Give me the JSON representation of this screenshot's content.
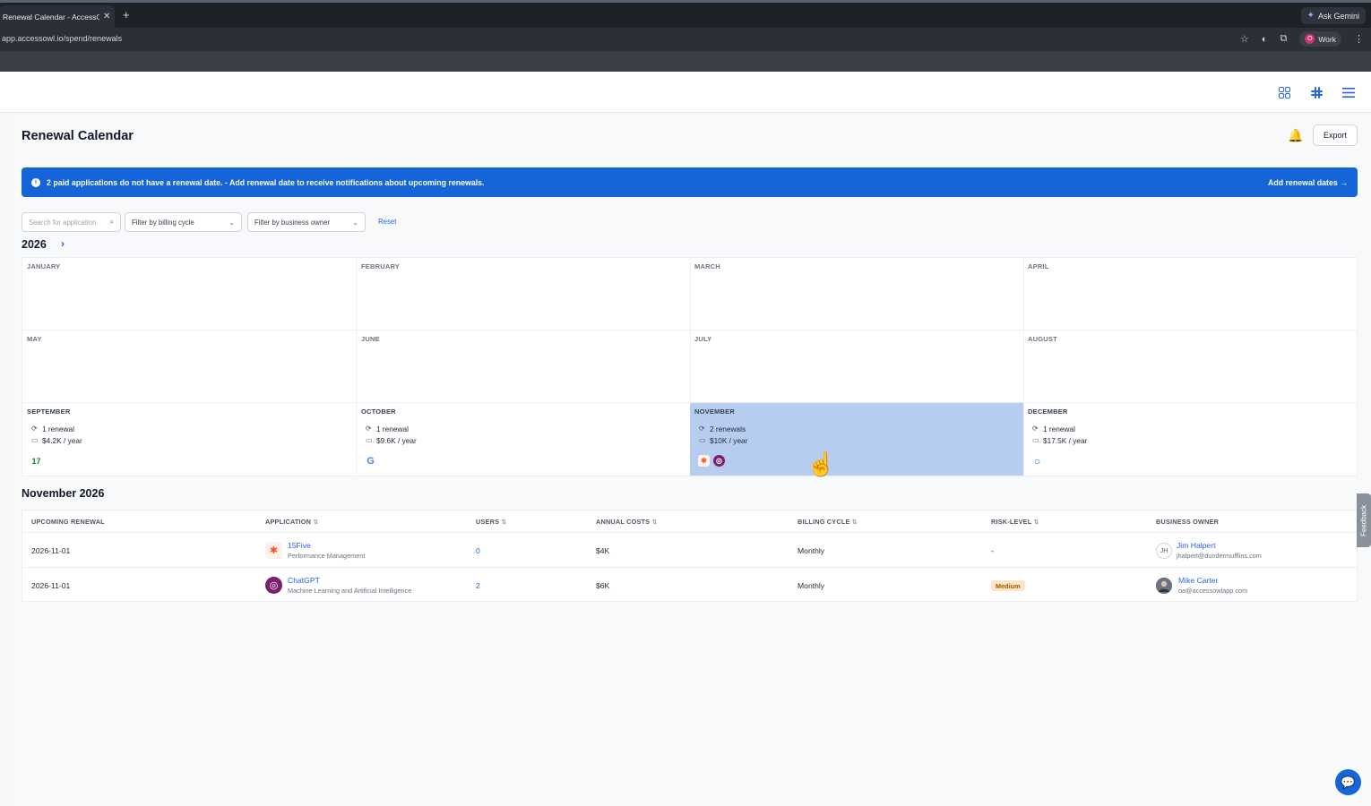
{
  "browser": {
    "tab_title": "Renewal Calendar - AccessOwl",
    "tab_close": "✕",
    "new_tab": "+",
    "ask_gemini": "Ask Gemini",
    "url": "app.accessowl.io/spend/renewals",
    "profile_initial": "O",
    "profile_label": "Work"
  },
  "page": {
    "title": "Renewal Calendar",
    "export_label": "Export"
  },
  "banner": {
    "message": "2 paid applications do not have a renewal date. - Add renewal date to receive notifications about upcoming renewals.",
    "action": "Add renewal dates →"
  },
  "filters": {
    "search_placeholder": "Search for application",
    "billing_cycle": "Filter by billing cycle",
    "business_owner": "Filter by business owner",
    "reset": "Reset"
  },
  "calendar": {
    "year": "2026",
    "months": [
      {
        "name": "JANUARY"
      },
      {
        "name": "FEBRUARY"
      },
      {
        "name": "MARCH"
      },
      {
        "name": "APRIL"
      },
      {
        "name": "MAY"
      },
      {
        "name": "JUNE"
      },
      {
        "name": "JULY"
      },
      {
        "name": "AUGUST"
      },
      {
        "name": "SEPTEMBER",
        "renewals": "1 renewal",
        "cost": "$4.2K / year",
        "apps": [
          "17"
        ]
      },
      {
        "name": "OCTOBER",
        "renewals": "1 renewal",
        "cost": "$9.6K / year",
        "apps": [
          "G"
        ]
      },
      {
        "name": "NOVEMBER",
        "renewals": "2 renewals",
        "cost": "$10K / year",
        "apps": [
          "15Five",
          "ChatGPT"
        ]
      },
      {
        "name": "DECEMBER",
        "renewals": "1 renewal",
        "cost": "$17.5K / year",
        "apps": [
          "O"
        ]
      }
    ]
  },
  "table": {
    "title": "November 2026",
    "headers": [
      "UPCOMING RENEWAL",
      "APPLICATION",
      "USERS",
      "ANNUAL COSTS",
      "BILLING CYCLE",
      "RISK-LEVEL",
      "BUSINESS OWNER"
    ],
    "rows": [
      {
        "renewal": "2026-11-01",
        "app_name": "15Five",
        "app_category": "Performance Management",
        "users": "0",
        "annual_cost": "$4K",
        "billing_cycle": "Monthly",
        "risk": "-",
        "owner_initials": "JH",
        "owner_name": "Jim Halpert",
        "owner_email": "jhalpert@dundermufflins.com"
      },
      {
        "renewal": "2026-11-01",
        "app_name": "ChatGPT",
        "app_category": "Machine Learning and Artificial Intelligence",
        "users": "2",
        "annual_cost": "$6K",
        "billing_cycle": "Monthly",
        "risk": "Medium",
        "owner_name": "Mike Carter",
        "owner_email": "oa@accessowlapp.com"
      }
    ]
  },
  "widgets": {
    "feedback": "Feedback"
  },
  "colors": {
    "primary": "#1565d8",
    "selected_month": "#b7cdef",
    "risk_medium_bg": "#fde7c8"
  }
}
